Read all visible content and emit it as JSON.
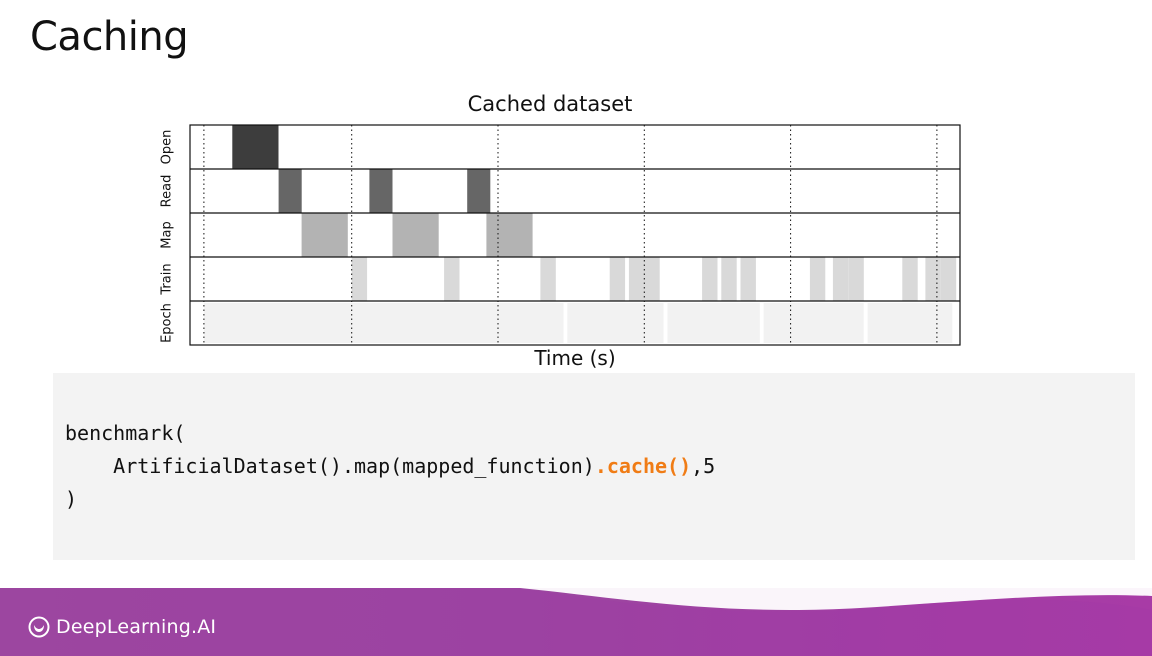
{
  "slide": {
    "title": "Caching"
  },
  "chart_data": {
    "type": "timeline",
    "title": "Cached dataset",
    "xlabel": "Time (s)",
    "rows": [
      "Open",
      "Read",
      "Map",
      "Train",
      "Epoch"
    ],
    "epoch_markers": [
      0.018,
      0.21,
      0.4,
      0.59,
      0.78,
      0.97
    ],
    "rows_data": {
      "Open": [
        [
          0.055,
          0.115
        ]
      ],
      "Read": [
        [
          0.115,
          0.145
        ],
        [
          0.233,
          0.263
        ],
        [
          0.36,
          0.39
        ]
      ],
      "Map": [
        [
          0.145,
          0.205
        ],
        [
          0.263,
          0.323
        ],
        [
          0.385,
          0.445
        ]
      ],
      "Train": [
        [
          0.21,
          0.23
        ],
        [
          0.33,
          0.35
        ],
        [
          0.455,
          0.475
        ],
        [
          0.545,
          0.565
        ],
        [
          0.57,
          0.61
        ],
        [
          0.665,
          0.685
        ],
        [
          0.69,
          0.71
        ],
        [
          0.715,
          0.735
        ],
        [
          0.805,
          0.825
        ],
        [
          0.835,
          0.855
        ],
        [
          0.855,
          0.875
        ],
        [
          0.925,
          0.945
        ],
        [
          0.955,
          0.975
        ],
        [
          0.975,
          0.995
        ]
      ],
      "Epoch": [
        [
          0.018,
          0.485
        ],
        [
          0.49,
          0.615
        ],
        [
          0.62,
          0.74
        ],
        [
          0.745,
          0.875
        ],
        [
          0.88,
          0.99
        ]
      ]
    },
    "colors": {
      "Open": "#3d3d3d",
      "Read": "#666666",
      "Map": "#b3b3b3",
      "Train": "#d9d9d9",
      "Epoch": "#f2f2f2"
    }
  },
  "code": {
    "line1": "benchmark(",
    "line2_prefix": "    ArtificialDataset().map(mapped_function)",
    "line2_highlight": ".cache()",
    "line2_suffix": ",5",
    "line3": ")"
  },
  "footer": {
    "brand": "DeepLearning.AI"
  }
}
